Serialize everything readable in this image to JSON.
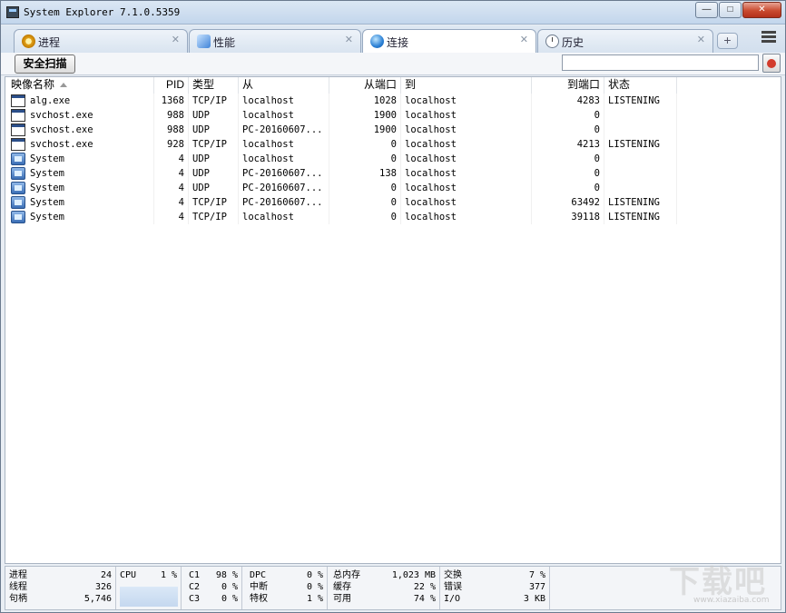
{
  "window": {
    "title": "System Explorer 7.1.0.5359"
  },
  "tabs": [
    {
      "label": "进程",
      "icon": "gear-icon"
    },
    {
      "label": "性能",
      "icon": "performance-icon"
    },
    {
      "label": "连接",
      "icon": "globe-icon",
      "active": true
    },
    {
      "label": "历史",
      "icon": "clock-icon"
    }
  ],
  "toolbar": {
    "scan_label": "安全扫描",
    "search_value": ""
  },
  "table": {
    "headers": {
      "image": "映像名称",
      "pid": "PID",
      "type": "类型",
      "from": "从",
      "from_port": "从端口",
      "to": "到",
      "to_port": "到端口",
      "state": "状态"
    },
    "rows": [
      {
        "icon": "application-icon",
        "image": "alg.exe",
        "pid": "1368",
        "type": "TCP/IP",
        "from": "localhost",
        "from_port": "1028",
        "to": "localhost",
        "to_port": "4283",
        "state": "LISTENING"
      },
      {
        "icon": "application-icon",
        "image": "svchost.exe",
        "pid": "988",
        "type": "UDP",
        "from": "localhost",
        "from_port": "1900",
        "to": "localhost",
        "to_port": "0",
        "state": ""
      },
      {
        "icon": "application-icon",
        "image": "svchost.exe",
        "pid": "988",
        "type": "UDP",
        "from": "PC-20160607...",
        "from_port": "1900",
        "to": "localhost",
        "to_port": "0",
        "state": ""
      },
      {
        "icon": "application-icon",
        "image": "svchost.exe",
        "pid": "928",
        "type": "TCP/IP",
        "from": "localhost",
        "from_port": "0",
        "to": "localhost",
        "to_port": "4213",
        "state": "LISTENING"
      },
      {
        "icon": "system-icon",
        "image": "System",
        "pid": "4",
        "type": "UDP",
        "from": "localhost",
        "from_port": "0",
        "to": "localhost",
        "to_port": "0",
        "state": ""
      },
      {
        "icon": "system-icon",
        "image": "System",
        "pid": "4",
        "type": "UDP",
        "from": "PC-20160607...",
        "from_port": "138",
        "to": "localhost",
        "to_port": "0",
        "state": ""
      },
      {
        "icon": "system-icon",
        "image": "System",
        "pid": "4",
        "type": "UDP",
        "from": "PC-20160607...",
        "from_port": "0",
        "to": "localhost",
        "to_port": "0",
        "state": ""
      },
      {
        "icon": "system-icon",
        "image": "System",
        "pid": "4",
        "type": "TCP/IP",
        "from": "PC-20160607...",
        "from_port": "0",
        "to": "localhost",
        "to_port": "63492",
        "state": "LISTENING"
      },
      {
        "icon": "system-icon",
        "image": "System",
        "pid": "4",
        "type": "TCP/IP",
        "from": "localhost",
        "from_port": "0",
        "to": "localhost",
        "to_port": "39118",
        "state": "LISTENING"
      }
    ]
  },
  "status": {
    "procs": [
      {
        "label": "进程",
        "value": "24"
      },
      {
        "label": "线程",
        "value": "326"
      },
      {
        "label": "句柄",
        "value": "5,746"
      }
    ],
    "cpu": {
      "label": "CPU",
      "value": "1 %"
    },
    "cores": [
      {
        "label": "C1",
        "value": "98 %"
      },
      {
        "label": "C2",
        "value": "0 %"
      },
      {
        "label": "C3",
        "value": "0 %"
      }
    ],
    "intr": [
      {
        "label": "DPC",
        "value": "0 %"
      },
      {
        "label": "中断",
        "value": "0 %"
      },
      {
        "label": "特权",
        "value": "1 %"
      }
    ],
    "mem": [
      {
        "label": "总内存",
        "value": "1,023 MB"
      },
      {
        "label": "缓存",
        "value": "22 %"
      },
      {
        "label": "可用",
        "value": "74 %"
      }
    ],
    "io": [
      {
        "label": "交换",
        "value": "7 %"
      },
      {
        "label": "错误",
        "value": "377"
      },
      {
        "label": "I/O",
        "value": "3 KB"
      }
    ]
  },
  "watermark": {
    "main": "下载吧",
    "sub": "www.xiazaiba.com"
  }
}
